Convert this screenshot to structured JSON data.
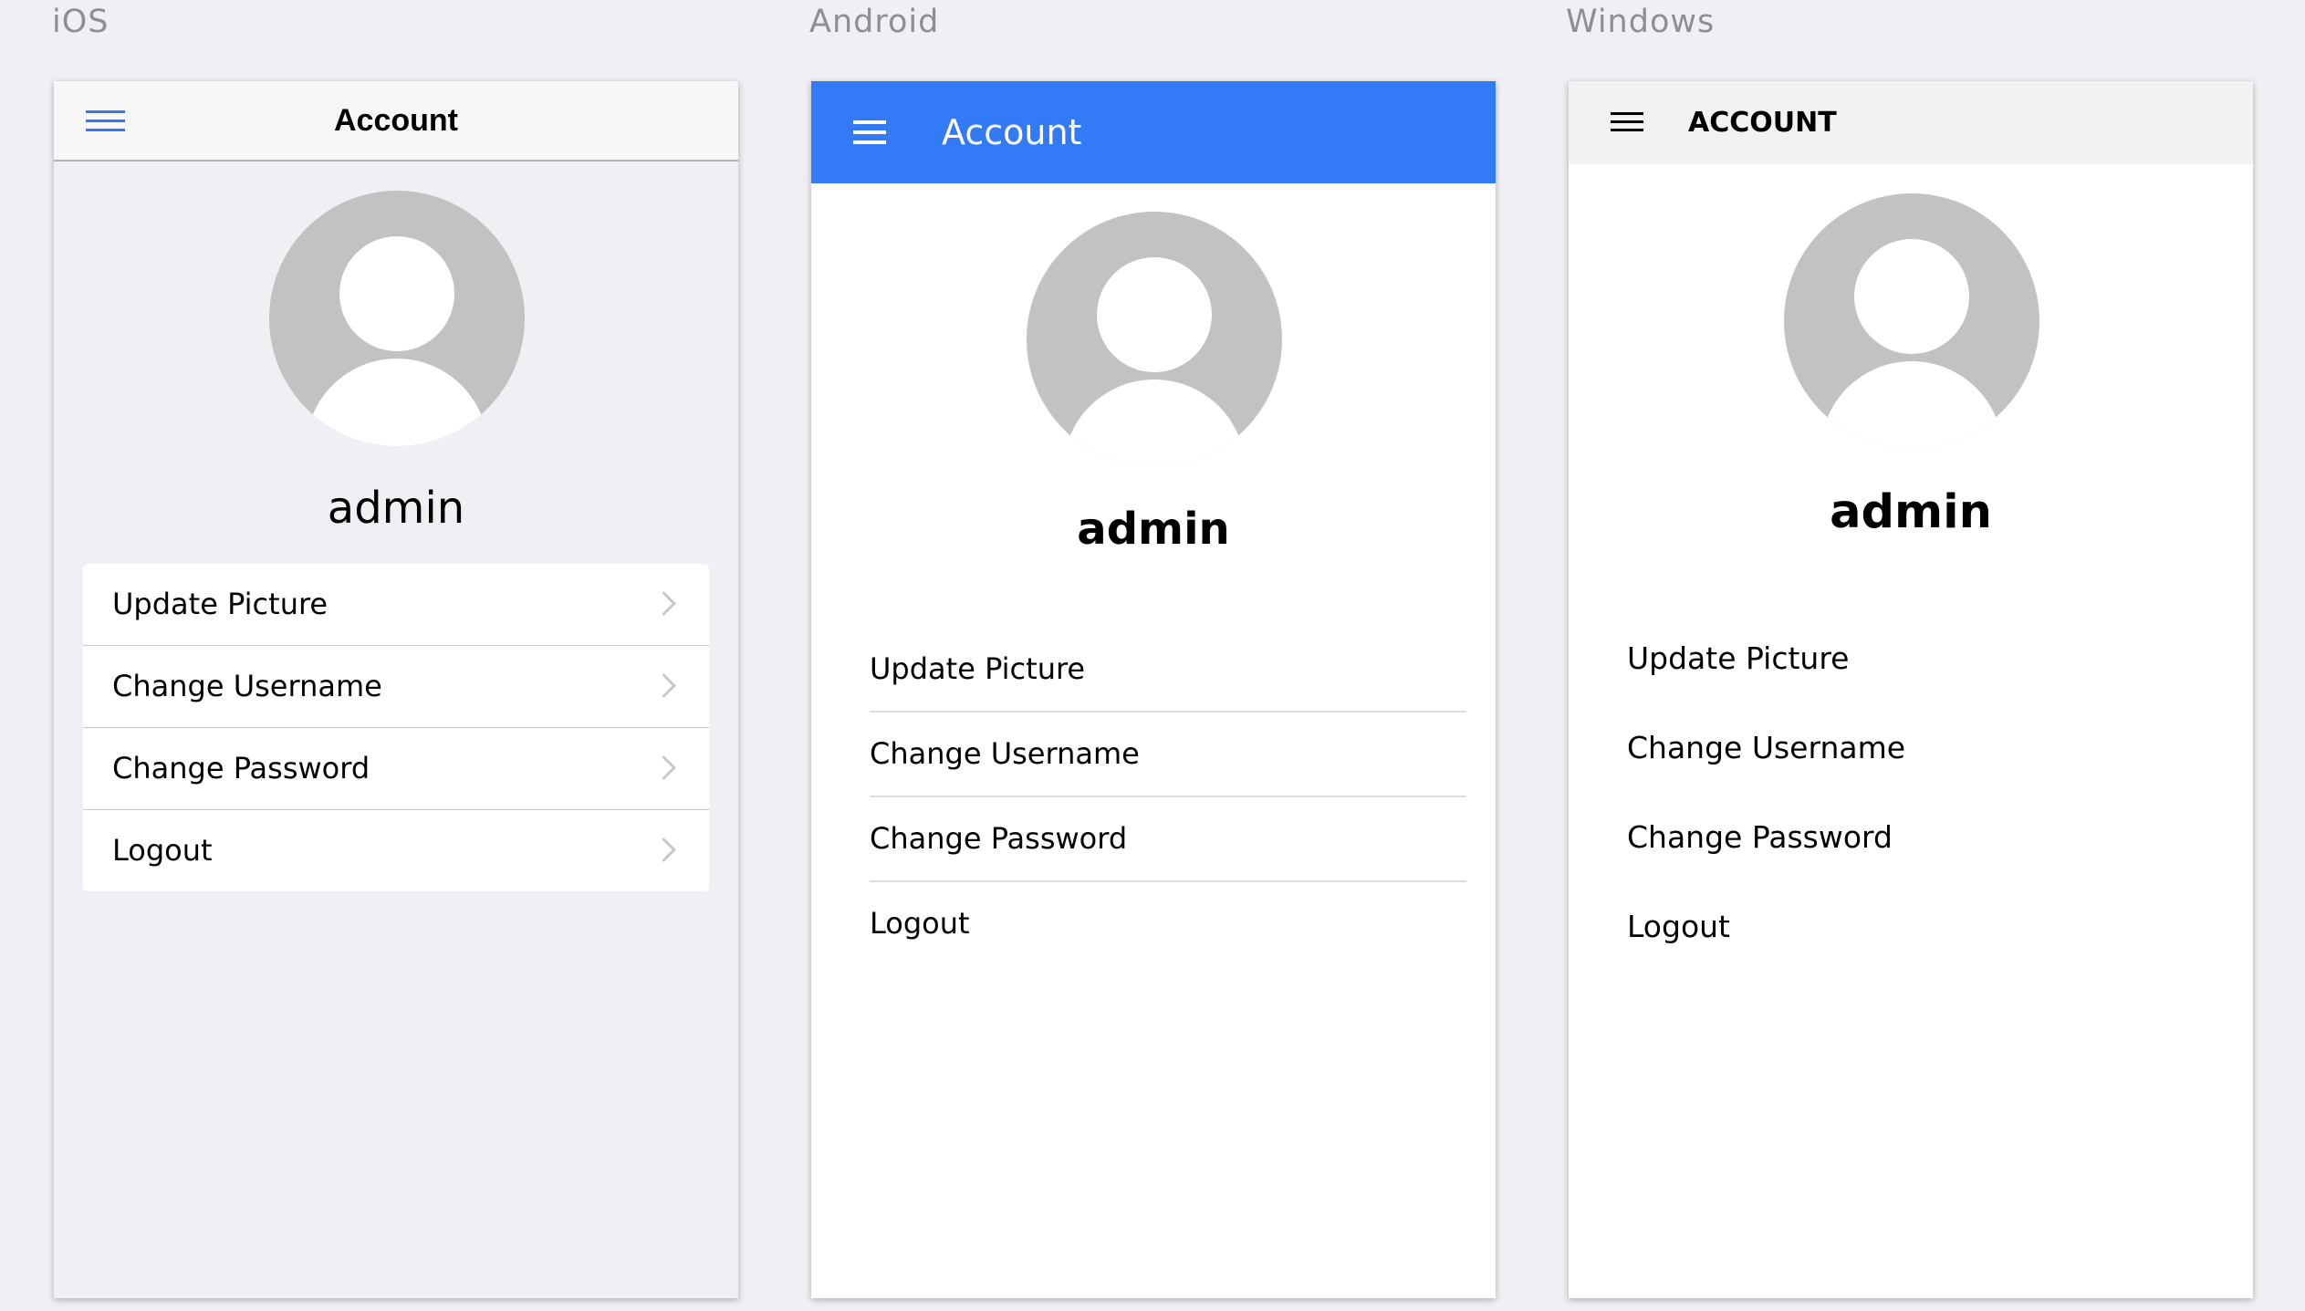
{
  "platforms": {
    "ios": {
      "label": "iOS",
      "title": "Account",
      "username": "admin",
      "menu": [
        {
          "label": "Update Picture"
        },
        {
          "label": "Change Username"
        },
        {
          "label": "Change Password"
        },
        {
          "label": "Logout"
        }
      ],
      "accent_color": "#3478f6"
    },
    "android": {
      "label": "Android",
      "title": "Account",
      "username": "admin",
      "menu": [
        {
          "label": "Update Picture"
        },
        {
          "label": "Change Username"
        },
        {
          "label": "Change Password"
        },
        {
          "label": "Logout"
        }
      ],
      "toolbar_color": "#337bf6"
    },
    "windows": {
      "label": "Windows",
      "title": "ACCOUNT",
      "username": "admin",
      "menu": [
        {
          "label": "Update Picture"
        },
        {
          "label": "Change Username"
        },
        {
          "label": "Change Password"
        },
        {
          "label": "Logout"
        }
      ]
    }
  },
  "icons": {
    "menu": "hamburger-icon",
    "avatar": "user-avatar-icon",
    "disclosure": "chevron-right-icon"
  },
  "colors": {
    "background": "#efeff4",
    "avatar_gray": "#c2c2c2",
    "separator": "#c8c7cc"
  }
}
